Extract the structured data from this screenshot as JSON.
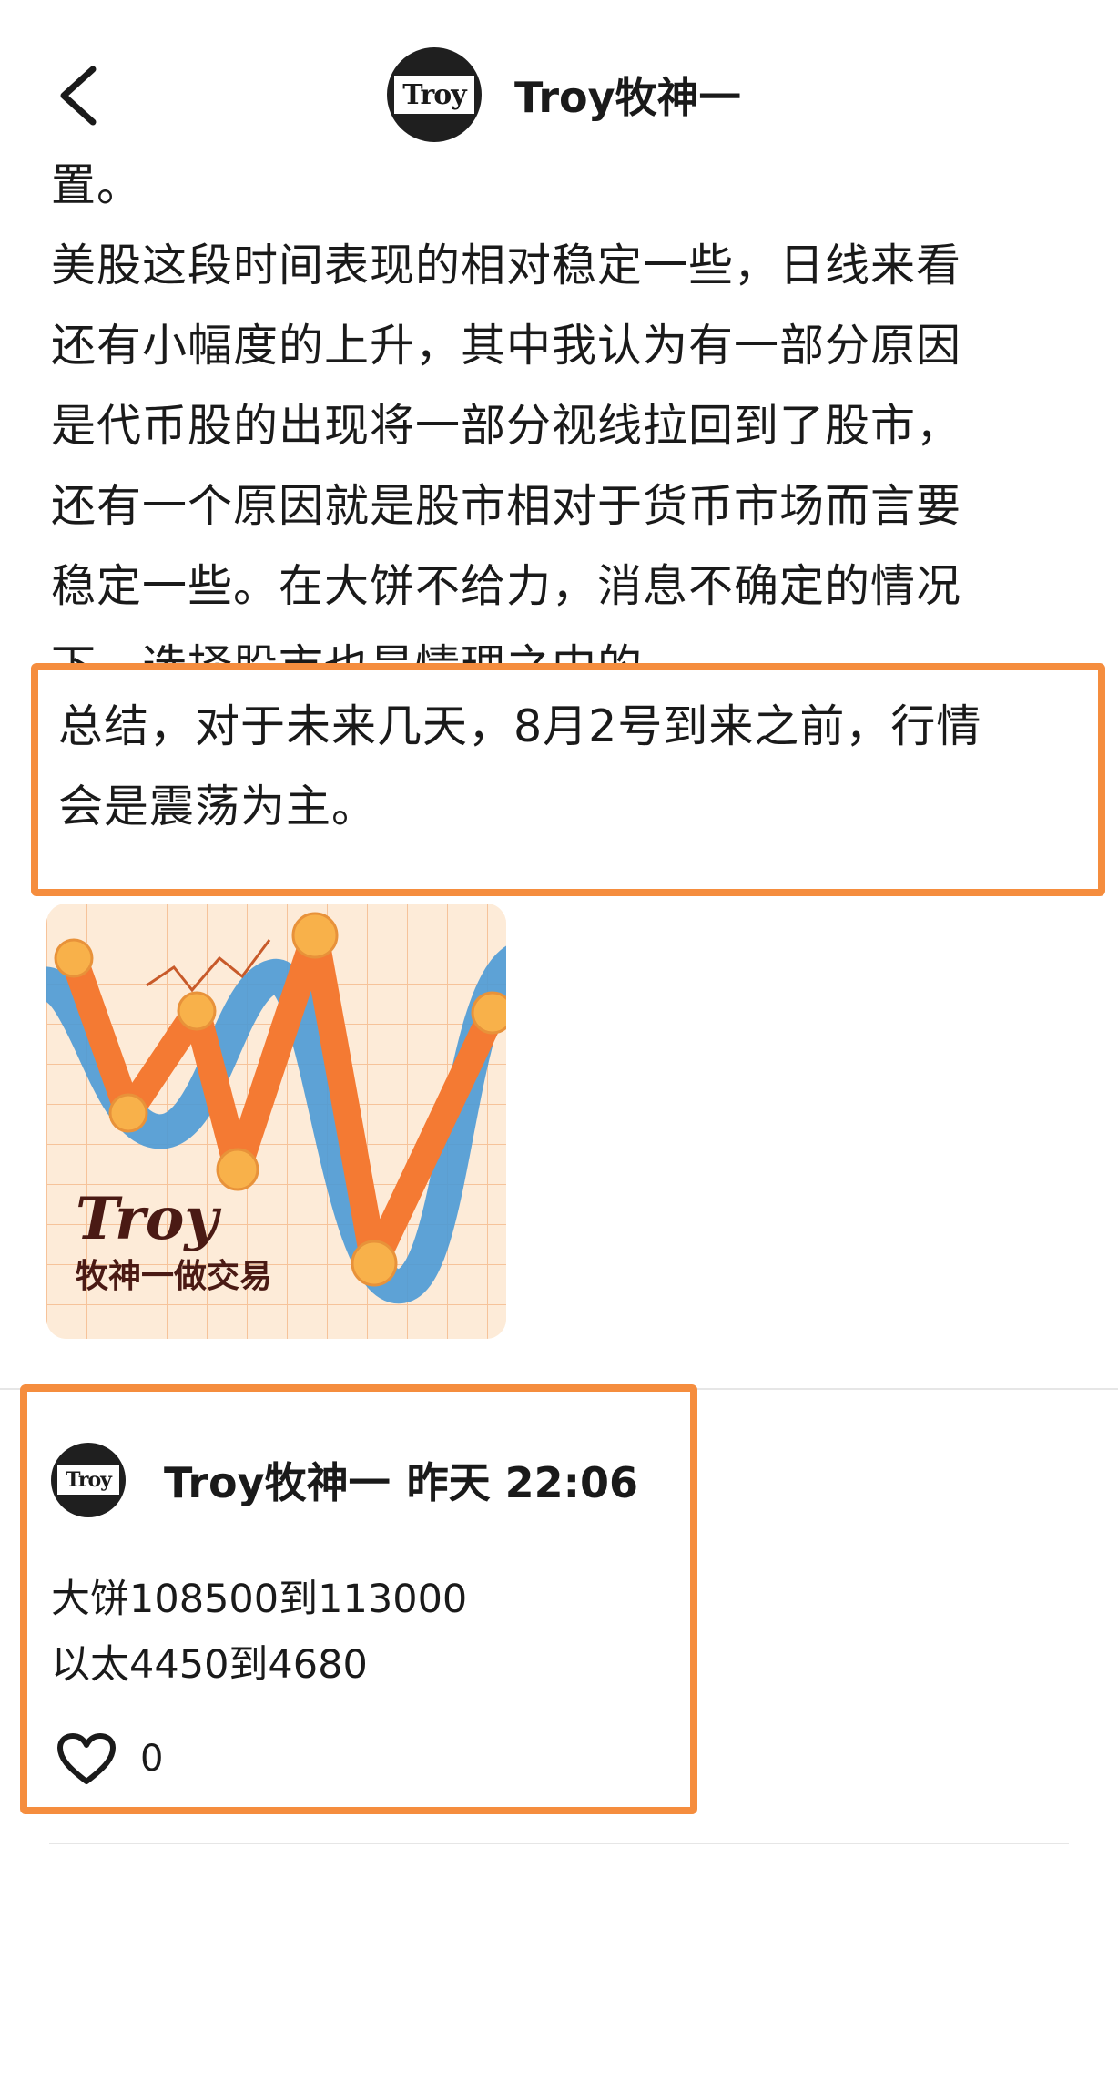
{
  "header": {
    "back_icon": "chevron-left-icon",
    "avatar_text": "Troy",
    "title": "Troy牧神一"
  },
  "article": {
    "lead_fragment": "置。",
    "paragraph_lines": [
      "美股这段时间表现的相对稳定一些，日线来看",
      "还有小幅度的上升，其中我认为有一部分原因",
      "是代币股的出现将一部分视线拉回到了股市，",
      "还有一个原因就是股市相对于货币市场而言要",
      "稳定一些。在大饼不给力，消息不确定的情况"
    ],
    "partial_line": "下，选择股市也是情理之中的。",
    "summary_lines": [
      "总结，对于未来几天，8月2号到来之前，行情",
      "会是震荡为主。"
    ]
  },
  "image": {
    "brand_line1": "Troy",
    "brand_line2": "牧神一做交易",
    "colors": {
      "background": "#fdebd8",
      "orange": "#f47a33",
      "blue": "#4b9ad6",
      "dot": "#f8b14a"
    }
  },
  "comment": {
    "avatar_text": "Troy",
    "author": "Troy牧神一",
    "time": "昨天 22:06",
    "lines": [
      "大饼108500到113000",
      "以太4450到4680"
    ],
    "like_icon": "heart-icon",
    "like_count": "0"
  },
  "colors": {
    "highlight_border": "#f58d3e",
    "text": "#1a1a1a",
    "divider": "#e6e6e6"
  }
}
